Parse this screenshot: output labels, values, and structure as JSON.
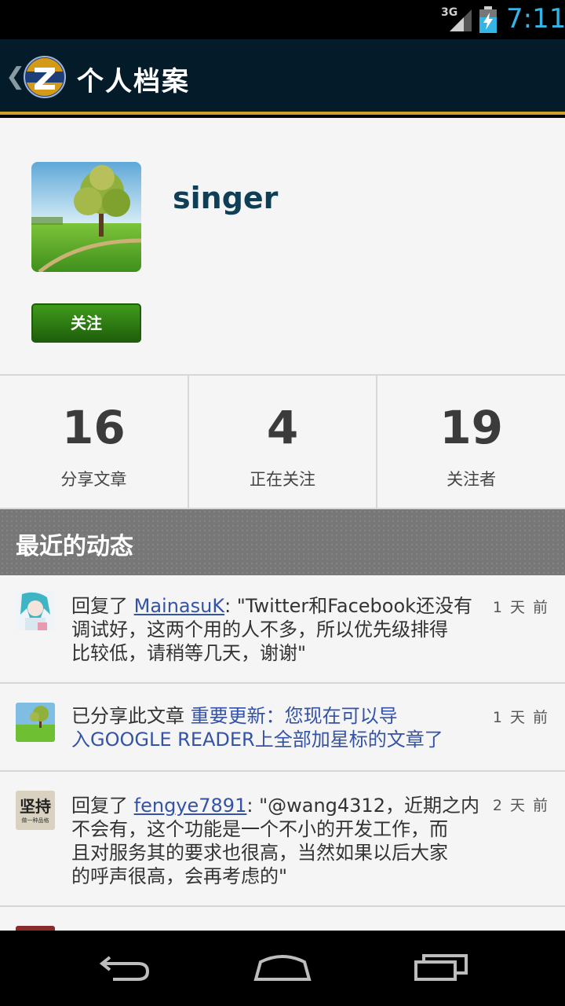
{
  "status_bar": {
    "network": "3G",
    "time": "7:11",
    "signal_icon": "signal-icon",
    "battery_icon": "battery-charging-icon"
  },
  "action_bar": {
    "back_icon": "back-chevron-icon",
    "title": "个人档案"
  },
  "profile": {
    "username": "singer",
    "follow_label": "关注"
  },
  "stats": [
    {
      "value": "16",
      "label": "分享文章"
    },
    {
      "value": "4",
      "label": "正在关注"
    },
    {
      "value": "19",
      "label": "关注者"
    }
  ],
  "section": {
    "title": "最近的动态"
  },
  "feed": [
    {
      "prefix": "回复了 ",
      "user": "MainasuK",
      "text_line1": ": \"Twitter和Facebook还没有",
      "text_line2": "调试好，这两个用的人不多，所以优先级排得",
      "text_line3": "比较低，请稍等几天，谢谢\"",
      "time": "1 天 前"
    },
    {
      "prefix": "已分享此文章 ",
      "link_line1": "重要更新：您现在可以导",
      "link_line2": "入GOOGLE READER上全部加星标的文章了",
      "time": "1 天 前"
    },
    {
      "prefix": "回复了 ",
      "user": "fengye7891",
      "text_line1": ": \"@wang4312，近期之内",
      "text_line2": "不会有，这个功能是一个不小的开发工作，而",
      "text_line3": "且对服务其的要求也很高，当然如果以后大家",
      "text_line4": "的呼声很高，会再考虑的\"",
      "time": "2 天 前",
      "avatar_text": "坚持",
      "avatar_subtext": "做一种品格"
    }
  ],
  "nav": {
    "back": "nav-back-icon",
    "home": "nav-home-icon",
    "recents": "nav-recents-icon"
  }
}
